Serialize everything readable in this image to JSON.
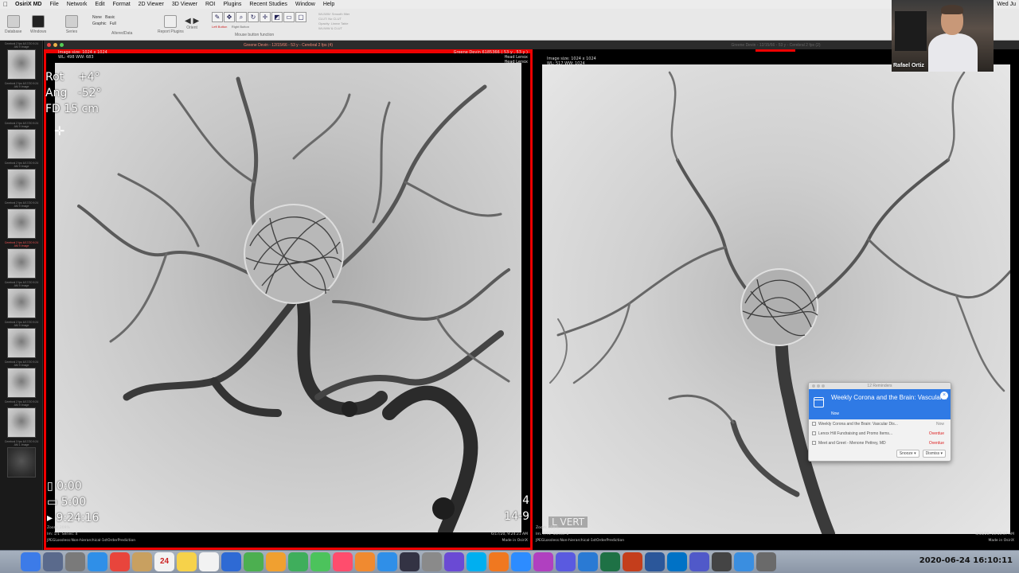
{
  "menubar": {
    "app_name": "OsiriX MD",
    "items": [
      "File",
      "Network",
      "Edit",
      "Format",
      "2D Viewer",
      "3D Viewer",
      "ROI",
      "Plugins",
      "Recent Studies",
      "Window",
      "Help"
    ],
    "clock": "Wed Ju"
  },
  "toolbar": {
    "labels": [
      "Database",
      "Windows",
      "Series",
      "AlteredData",
      "Report Plugins",
      "Orient",
      "Mouse button function",
      "WL/WW & CLUT"
    ],
    "radio": [
      "None",
      "Graphic",
      "Basic",
      "Full"
    ],
    "tool_glyphs": [
      "✎",
      "✥",
      "⌕",
      "↻",
      "✛",
      "◩",
      "▭",
      "▢"
    ],
    "left_button": "Left Button",
    "right_button": "Right Button",
    "wlww_lines": [
      "WL/WW: Smooth filter",
      "CLUT: No CLUT",
      "Opacity: Linear Table"
    ]
  },
  "thumbnails": [
    {
      "caption": "Cerebral 2 fps 6/17/20 9:24 AM 9 Image",
      "dark": false,
      "highlight": false
    },
    {
      "caption": "Cerebral 2 fps 6/17/20 9:24 AM 9 Image",
      "dark": false,
      "highlight": false
    },
    {
      "caption": "Cerebral 2 fps 6/17/20 9:24 AM 9 Image",
      "dark": false,
      "highlight": false
    },
    {
      "caption": "Cerebral 2 fps 6/17/20 9:24 AM 9 Image",
      "dark": false,
      "highlight": false
    },
    {
      "caption": "Cerebral 2 fps 6/17/20 9:24 AM 9 Image",
      "dark": false,
      "highlight": false
    },
    {
      "caption": "Cerebral 2 fps 6/17/20 9:24 AM 9 Image",
      "dark": false,
      "highlight": true
    },
    {
      "caption": "Cerebral 2 fps 6/17/20 9:24 AM 9 Image",
      "dark": false,
      "highlight": false
    },
    {
      "caption": "Cerebral 2 fps 6/17/20 9:24 AM 9 Image",
      "dark": false,
      "highlight": false
    },
    {
      "caption": "Cerebral 2 fps 6/17/20 9:24 AM 9 Image",
      "dark": false,
      "highlight": false
    },
    {
      "caption": "Cerebral 2 fps 6/17/20 9:24 AM 9 Image",
      "dark": false,
      "highlight": false
    },
    {
      "caption": "Cerebral 3 fps 6/17/20 9:24 AM 1 Image",
      "dark": true,
      "highlight": false
    }
  ],
  "left_viewer": {
    "title": "Greene Devin - 12/15/66 - 53 y - Cerebral 2 fps (4)",
    "image_size": "Image size: 1024 x 1024",
    "wl_ww": "WL: 498 WW: 683",
    "patient_id": "Greene Devin 6185366 ( 53 y , 53 y )",
    "institution": "Head Lenox",
    "institution2": "Head Lenox",
    "rot": "Rot    +4°",
    "ang": "Ang   -52°",
    "fd": "FD 15 cm",
    "time1": "0:00",
    "time2": "5:00",
    "time3": "9:24:16",
    "corner_num": "4",
    "corner_num2": "14-9",
    "bottom_line1": "Zoom: 209%",
    "bottom_line2": "Im: 1/1  Series: 4",
    "bottom_line3": "JPEGLossless:Non-hierarchical-1stOrderPrediction",
    "bottom_right1": "6/17/20, 9:24:21 AM",
    "bottom_right2": "Made in OsiriX"
  },
  "right_viewer": {
    "title": "Greene Devin - 12/15/66 - 53 y - Cerebral 2 fps (2)",
    "image_size": "Image size: 1024 x 1024",
    "wl_ww": "WL: 517 WW: 1024",
    "vert": "L VERT",
    "bottom_line1": "Zoom: 209%",
    "bottom_line2": "Im: 7/73  Series: 6",
    "bottom_line3": "JPEGLossless:Non-hierarchical-1stOrderPrediction",
    "bottom_right1": "3/16/20, 10:55:37 AM",
    "bottom_right2": "Made in OsiriX"
  },
  "notification": {
    "header": "12 Reminders",
    "title": "Weekly Corona and the Brain: Vascular...",
    "now": "Now",
    "rows": [
      {
        "text": "Weekly Corona and the Brain: Vascular Dis...",
        "status": "Now"
      },
      {
        "text": "Lenox Hill Fundraising and Promo Items...",
        "status": "Overdue"
      },
      {
        "text": "Meet and Greet - Menone Pettrey, MD",
        "status": "Overdue"
      }
    ],
    "snooze": "Snooze ▾",
    "dismiss": "Dismiss ▾"
  },
  "webcam": {
    "name": "Rafael Ortiz"
  },
  "dock": {
    "icons": [
      "finder-icon",
      "launchpad-icon",
      "rocket-icon",
      "safari-icon",
      "chrome-icon",
      "folder-icon",
      "calendar-icon",
      "notes-icon",
      "reminders-icon",
      "app-icon",
      "maps-icon",
      "photos-icon",
      "facetime-icon",
      "messages-icon",
      "itunes-icon",
      "books-icon",
      "appstore-icon",
      "osirix-icon",
      "prefs-icon",
      "star-icon",
      "skype-icon",
      "vlc-icon",
      "zoom-icon",
      "app2-icon",
      "app3-icon",
      "onedrive-icon",
      "excel-icon",
      "powerpoint-icon",
      "word-icon",
      "outlook-icon",
      "teams-icon",
      "quicktime-icon",
      "app4-icon",
      "app5-icon"
    ],
    "calendar_day": "24",
    "clock": "2020-06-24 16:10:11"
  },
  "colors": {
    "accent_red": "#e00000",
    "notif_blue": "#2f7ae5"
  }
}
